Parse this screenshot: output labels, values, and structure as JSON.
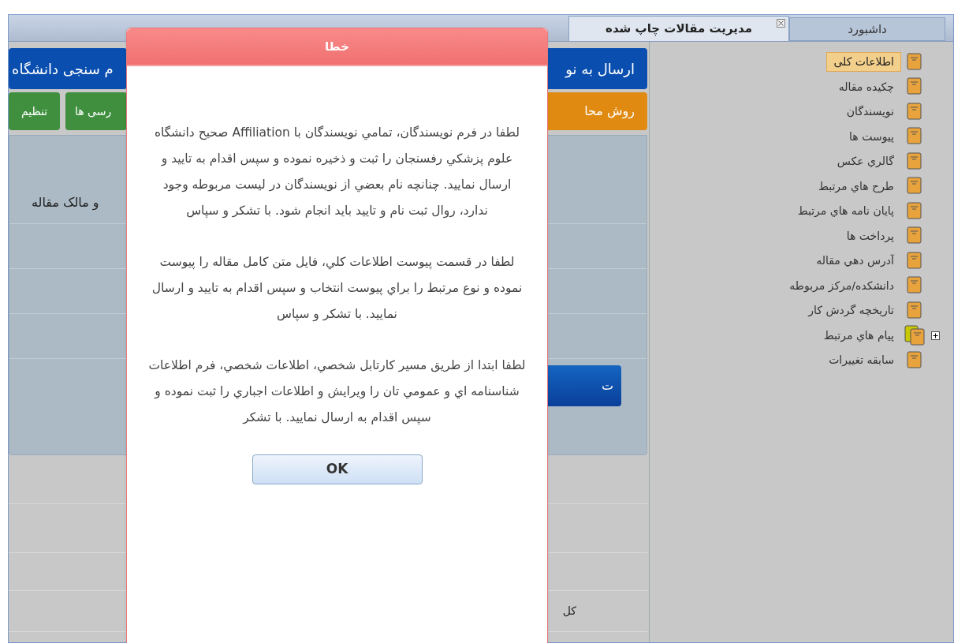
{
  "tabs": [
    {
      "label": "داشبورد",
      "selected": false,
      "closable": false
    },
    {
      "label": "مديريت مقالات چاپ شده",
      "selected": true,
      "closable": true
    }
  ],
  "toolbar": {
    "row_1": [
      {
        "label": "ارسال به نو",
        "color": "#0a4fb0"
      },
      {
        "label": "م سنجی دانشگاه",
        "color": "#0a4fb0"
      }
    ],
    "row_2": [
      {
        "label": "روش محا",
        "color": "#e08a12"
      },
      {
        "label": "رسی ها",
        "color": "#3f8f3f"
      },
      {
        "label": "تنظیم",
        "color": "#3f8f3f"
      }
    ]
  },
  "form_panel": {
    "label": "و مالک مقاله",
    "button": "ت"
  },
  "lower_rows": {
    "label": "کل"
  },
  "tree": [
    {
      "label": "اطلاعات کلی",
      "selected": true
    },
    {
      "label": "چكيده مقاله",
      "selected": false
    },
    {
      "label": "نويسندگان",
      "selected": false
    },
    {
      "label": "پيوست ها",
      "selected": false
    },
    {
      "label": "گالري عكس",
      "selected": false
    },
    {
      "label": "طرح هاي مرتبط",
      "selected": false
    },
    {
      "label": "پايان نامه هاي مرتبط",
      "selected": false
    },
    {
      "label": "پرداخت ها",
      "selected": false
    },
    {
      "label": "آدرس دهي مقاله",
      "selected": false
    },
    {
      "label": "دانشكده/مركز مربوطه",
      "selected": false
    },
    {
      "label": "تاريخچه گردش كار",
      "selected": false
    },
    {
      "label": "پيام هاي مرتبط",
      "selected": false,
      "expanded": false
    },
    {
      "label": "سابقه تغييرات",
      "selected": false
    }
  ],
  "dialog": {
    "title": "خطا",
    "paragraphs": [
      "لطفا در فرم نويسندگان، تمامي نويسندگان با Affiliation صحيح دانشگاه علوم پزشكي رفسنجان را ثبت و ذخيره نموده و سپس اقدام به تاييد و ارسال نماييد. چنانچه نام بعضي از نويسندگان در ليست مربوطه وجود ندارد، روال ثبت نام و تاييد بايد انجام شود. با تشكر و سپاس",
      "لطفا در قسمت پيوست اطلاعات كلي، فايل متن كامل مقاله را پيوست نموده و نوع مرتبط را براي پيوست انتخاب و سپس اقدام به تاييد و ارسال نماييد. با تشكر و سپاس",
      "لطفا ابتدا از طريق مسير كارتابل شخصي، اطلاعات شخصي، فرم اطلاعات شناسنامه اي و عمومي تان را ويرايش و اطلاعات اجباري را ثبت نموده و سپس اقدام به ارسال نماييد. با تشكر"
    ],
    "button": "OK"
  }
}
